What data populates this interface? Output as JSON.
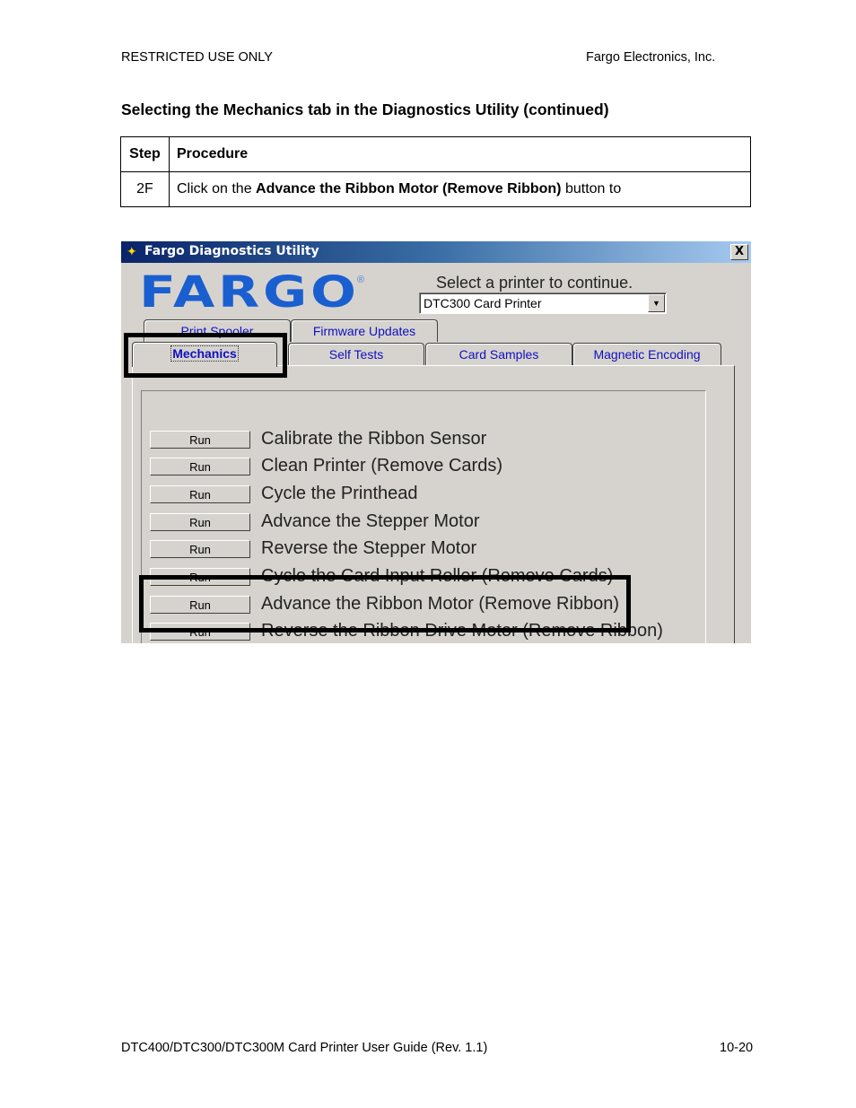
{
  "page_header": {
    "left": "RESTRICTED USE ONLY",
    "right": "Fargo Electronics, Inc."
  },
  "section_title": "Selecting the Mechanics tab in the Diagnostics Utility (continued)",
  "table": {
    "headers": [
      "Step",
      "Procedure"
    ],
    "rows": [
      {
        "step": "2F",
        "procedure_prefix": "Click on the ",
        "procedure_bold": "Advance the Ribbon Motor (Remove Ribbon)",
        "procedure_suffix": " button to"
      }
    ]
  },
  "screenshot": {
    "window_title": "Fargo Diagnostics Utility",
    "close_label": "X",
    "logo_text": "FARGO",
    "logo_mark": "®",
    "select_label": "Select a printer to continue.",
    "printer_value": "DTC300 Card Printer",
    "dropdown_arrow": "▼",
    "tabs_back": [
      "Print Spooler",
      "Firmware Updates"
    ],
    "tabs_front": [
      "Mechanics",
      "Self Tests",
      "Card Samples",
      "Magnetic Encoding"
    ],
    "active_tab": "Mechanics",
    "run_label": "Run",
    "actions": [
      "Calibrate the Ribbon Sensor",
      "Clean Printer (Remove Cards)",
      "Cycle the Printhead",
      "Advance the Stepper Motor",
      "Reverse the Stepper Motor",
      "Cycle the Card Input Roller (Remove Cards)",
      "Advance the Ribbon Motor (Remove Ribbon)",
      "Reverse the Ribbon Drive Motor (Remove Ribbon)"
    ],
    "colors": {
      "tab_text": "#1010c0",
      "logo": "#1a5fd0",
      "titlebar_start": "#0a246a",
      "titlebar_end": "#a6caf0"
    }
  },
  "page_footer": {
    "left": "DTC400/DTC300/DTC300M Card Printer User Guide (Rev. 1.1)",
    "right": "10-20"
  }
}
